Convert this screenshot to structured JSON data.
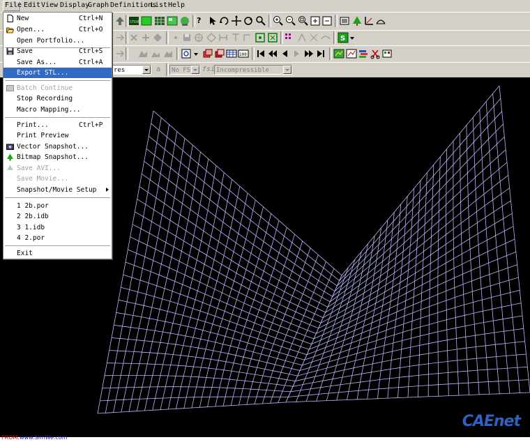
{
  "menubar": {
    "items": [
      {
        "label": "File",
        "key": "F",
        "rest": "ile"
      },
      {
        "label": "Edit",
        "key": "E",
        "rest": "dit"
      },
      {
        "label": "View",
        "key": "V",
        "rest": "iew"
      },
      {
        "label": "Display",
        "key": "D",
        "rest": "isplay"
      },
      {
        "label": "Graph",
        "key": "",
        "rest": "Graph"
      },
      {
        "label": "Definitions",
        "key": "",
        "rest": "Definitions"
      },
      {
        "label": "List",
        "key": "L",
        "rest": "ist"
      },
      {
        "label": "Help",
        "key": "H",
        "rest": "elp"
      }
    ]
  },
  "file_menu": {
    "new": {
      "label": "New",
      "shortcut": "Ctrl+N"
    },
    "open": {
      "label": "Open...",
      "shortcut": "Ctrl+O"
    },
    "open_portfolio": {
      "label": "Open Portfolio..."
    },
    "save": {
      "label": "Save",
      "shortcut": "Ctrl+S"
    },
    "save_as": {
      "label": "Save As...",
      "shortcut": "Ctrl+A"
    },
    "export_stl": {
      "label": "Export STL..."
    },
    "batch_continue": {
      "label": "Batch Continue"
    },
    "stop_recording": {
      "label": "Stop Recording"
    },
    "macro_mapping": {
      "label": "Macro Mapping..."
    },
    "print": {
      "label": "Print...",
      "shortcut": "Ctrl+P"
    },
    "print_preview": {
      "label": "Print Preview"
    },
    "vector_snapshot": {
      "label": "Vector Snapshot..."
    },
    "bitmap_snapshot": {
      "label": "Bitmap Snapshot..."
    },
    "save_avi": {
      "label": "Save AVI..."
    },
    "save_movie": {
      "label": "Save Movie..."
    },
    "snapshot_movie_setup": {
      "label": "Snapshot/Movie Setup"
    },
    "recent": [
      "1 2b.por",
      "2 2b.idb",
      "3 1.idb",
      "4 2.por"
    ],
    "exit": {
      "label": "Exit"
    }
  },
  "toolbar": {
    "combo_partial": "res",
    "combo_no_fsi": "No FSI",
    "fsi_label": "fsi",
    "combo_incompressible": "Incompressible"
  },
  "viewport": {
    "background": "#000000",
    "mesh_color": "#b8b8ff"
  },
  "watermark": {
    "text": "CAEnet"
  },
  "footer": {
    "prefix": "FROM:",
    "site": "www.SimWe.com"
  }
}
